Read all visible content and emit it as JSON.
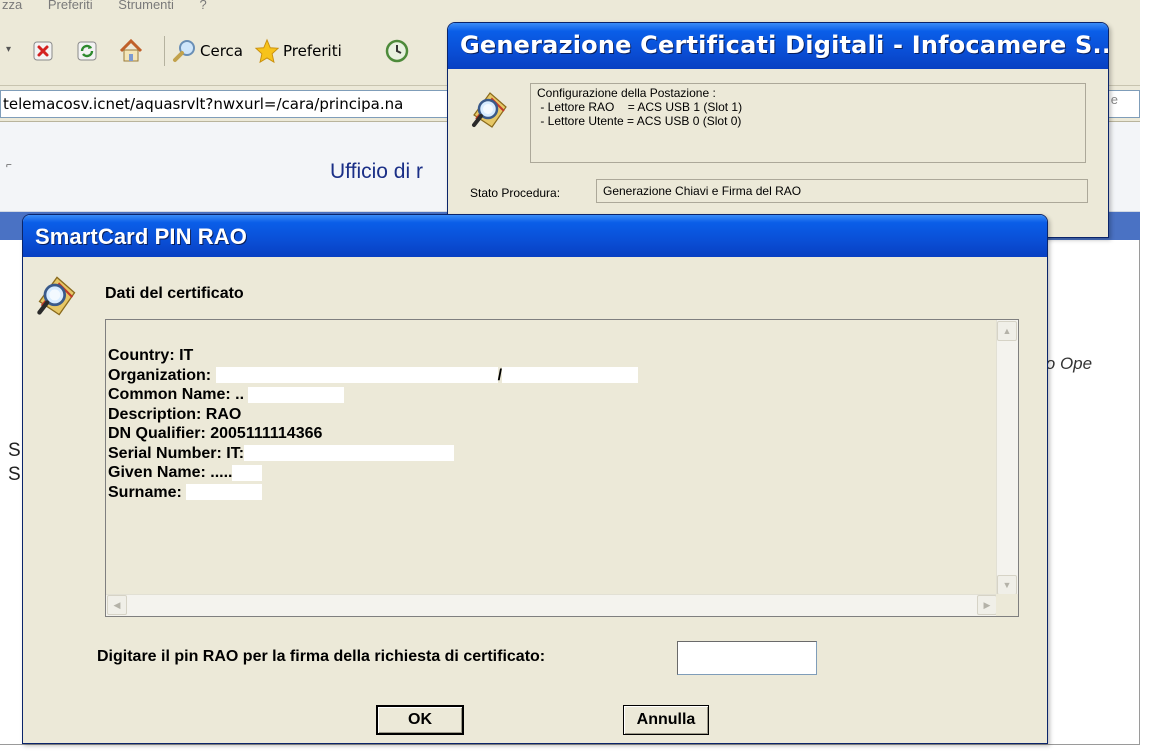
{
  "browser": {
    "menu": [
      "zza",
      "Preferiti",
      "Strumenti",
      "?"
    ],
    "toolbar": {
      "search_label": "Cerca",
      "favorites_label": "Preferiti"
    },
    "address": "telemacosv.icnet/aquasrvlt?nwxurl=/cara/principa.na",
    "address_edge": "e",
    "page_title": "Ufficio di r",
    "side_text": "io Ope",
    "left_letters": [
      "S",
      "S"
    ]
  },
  "gen_window": {
    "title": "Generazione Certificati Digitali - Infocamere S....",
    "config_lines": [
      "Configurazione della Postazione :",
      " - Lettore RAO    = ACS USB 1 (Slot 1)",
      " - Lettore Utente = ACS USB 0 (Slot 0)"
    ],
    "stato_label": "Stato Procedura:",
    "stato_value": "Generazione Chiavi e Firma del RAO"
  },
  "sc_window": {
    "title": "SmartCard PIN RAO",
    "heading": "Dati del certificato",
    "cert": {
      "country": "Country: IT",
      "organization": "Organization:",
      "org_tail": "/",
      "common_name": "Common Name: ..",
      "description": "Description: RAO",
      "dn_qualifier": "DN Qualifier: 2005111114366",
      "serial_number": "Serial Number: IT:",
      "given_name": "Given Name: .....",
      "surname": "Surname:"
    },
    "pin_label": "Digitare il pin RAO per la firma della richiesta di certificato:",
    "pin_value": "",
    "ok_label": "OK",
    "cancel_label": "Annulla"
  },
  "colors": {
    "xp_title": "#0a4fd6",
    "dialog_bg": "#ece9d8",
    "page_title": "#1a2f87"
  }
}
